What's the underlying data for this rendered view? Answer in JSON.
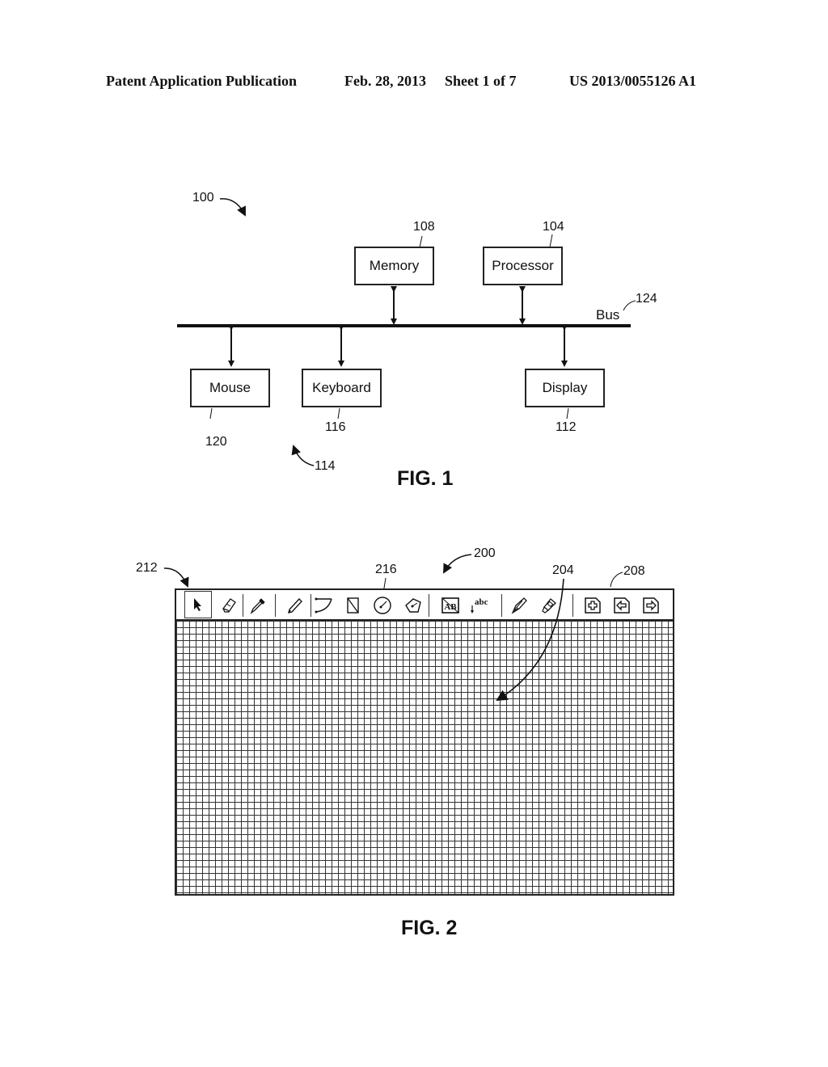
{
  "header": {
    "publication": "Patent Application Publication",
    "date": "Feb. 28, 2013",
    "sheet": "Sheet 1 of 7",
    "number": "US 2013/0055126 A1"
  },
  "fig1": {
    "caption": "FIG. 1",
    "ref_system": "100",
    "ref_input_group": "114",
    "bus": {
      "label": "Bus",
      "ref": "124"
    },
    "components": [
      {
        "label": "Memory",
        "ref": "108"
      },
      {
        "label": "Processor",
        "ref": "104"
      },
      {
        "label": "Mouse",
        "ref": "120"
      },
      {
        "label": "Keyboard",
        "ref": "116"
      },
      {
        "label": "Display",
        "ref": "112"
      }
    ]
  },
  "fig2": {
    "caption": "FIG. 2",
    "ref_ui": "200",
    "ref_canvas": "204",
    "ref_page_tools": "208",
    "ref_toolbar": "212",
    "ref_circle_tool": "216",
    "abc_label": "abc",
    "ab_label": "AB",
    "tools": [
      "select-pointer",
      "eraser",
      "eyedropper",
      "pencil",
      "arc",
      "rectangle-diagonal",
      "circle",
      "polygon",
      "text-box",
      "insert-text",
      "pen",
      "highlighter",
      "add-page",
      "previous-page",
      "next-page"
    ]
  }
}
